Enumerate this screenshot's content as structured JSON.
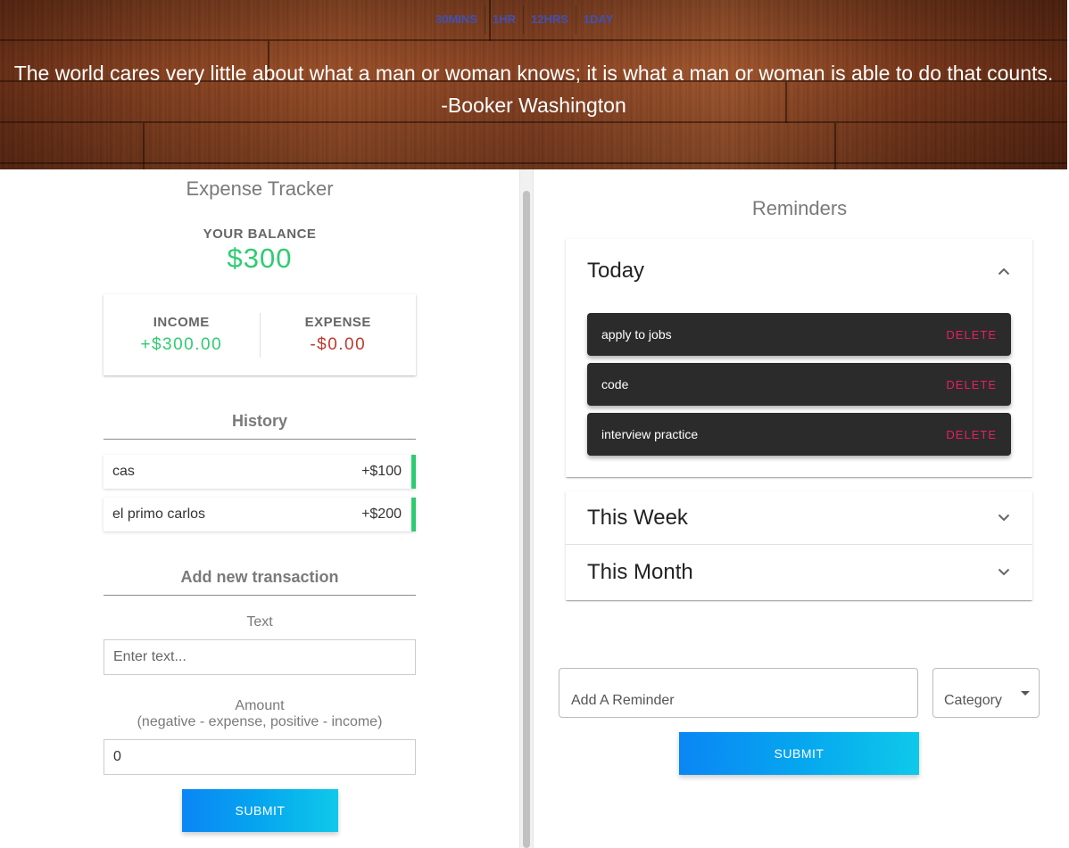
{
  "header": {
    "timer_tabs": [
      "30MINS",
      "1HR",
      "12HRS",
      "1DAY"
    ],
    "quote": "The world cares very little about what a man or woman knows; it is what a man or woman is able to do that counts. -Booker Washington"
  },
  "expense": {
    "title": "Expense Tracker",
    "balance_label": "YOUR BALANCE",
    "balance_value": "$300",
    "income_label": "INCOME",
    "income_value": "+$300.00",
    "expense_label": "EXPENSE",
    "expense_value": "-$0.00",
    "history_title": "History",
    "history": [
      {
        "text": "cas",
        "amount": "+$100"
      },
      {
        "text": "el primo carlos",
        "amount": "+$200"
      }
    ],
    "add_title": "Add new transaction",
    "text_label": "Text",
    "text_placeholder": "Enter text...",
    "amount_label": "Amount",
    "amount_hint": "(negative - expense, positive - income)",
    "amount_value": "0",
    "submit_label": "SUBMIT"
  },
  "reminders": {
    "title": "Reminders",
    "sections": [
      {
        "title": "Today",
        "expanded": true,
        "icon": "chevron-up-icon"
      },
      {
        "title": "This Week",
        "expanded": false,
        "icon": "chevron-down-icon"
      },
      {
        "title": "This Month",
        "expanded": false,
        "icon": "chevron-down-icon"
      }
    ],
    "today_tasks": [
      {
        "text": "apply to jobs",
        "action": "DELETE"
      },
      {
        "text": "code",
        "action": "DELETE"
      },
      {
        "text": "interview practice",
        "action": "DELETE"
      }
    ],
    "input_placeholder": "Add A Reminder",
    "category_label": "Category",
    "submit_label": "SUBMIT"
  },
  "colors": {
    "positive": "#2ecc71",
    "negative": "#c0392b",
    "delete": "#e91e63",
    "tab_text": "#3f51b5",
    "button_gradient_start": "#0a86f5",
    "button_gradient_end": "#0ec9ea"
  }
}
